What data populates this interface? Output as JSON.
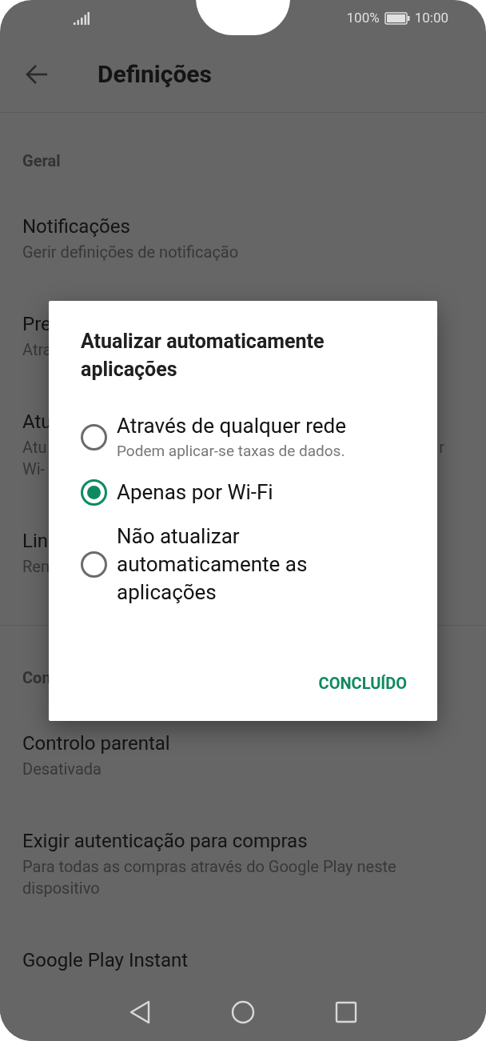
{
  "status_bar": {
    "battery": "100%",
    "time": "10:00"
  },
  "header": {
    "title": "Definições"
  },
  "sections": [
    {
      "header": "Geral",
      "items": [
        {
          "title": "Notificações",
          "subtitle": "Gerir definições de notificação"
        },
        {
          "title": "Pre",
          "subtitle": "Atra"
        },
        {
          "title": "Atu",
          "subtitle": "Atu",
          "subtitle_right": "r",
          "subtitle_line_2": "Wi-"
        },
        {
          "title": "Lin",
          "subtitle": "Ren"
        }
      ]
    },
    {
      "header": "Con",
      "items": [
        {
          "title": "Controlo parental",
          "subtitle": "Desativada"
        },
        {
          "title": "Exigir autenticação para compras",
          "subtitle": "Para todas as compras através do Google Play neste dispositivo"
        },
        {
          "title": "Google Play Instant"
        }
      ]
    }
  ],
  "dialog": {
    "title": "Atualizar automaticamente aplicações",
    "options": [
      {
        "label": "Através de qualquer rede",
        "detail": "Podem aplicar-se taxas de dados.",
        "selected": false
      },
      {
        "label": "Apenas por Wi-Fi",
        "selected": true
      },
      {
        "label": "Não atualizar automaticamente as aplicações",
        "selected": false
      }
    ],
    "button": "CONCLUÍDO"
  }
}
